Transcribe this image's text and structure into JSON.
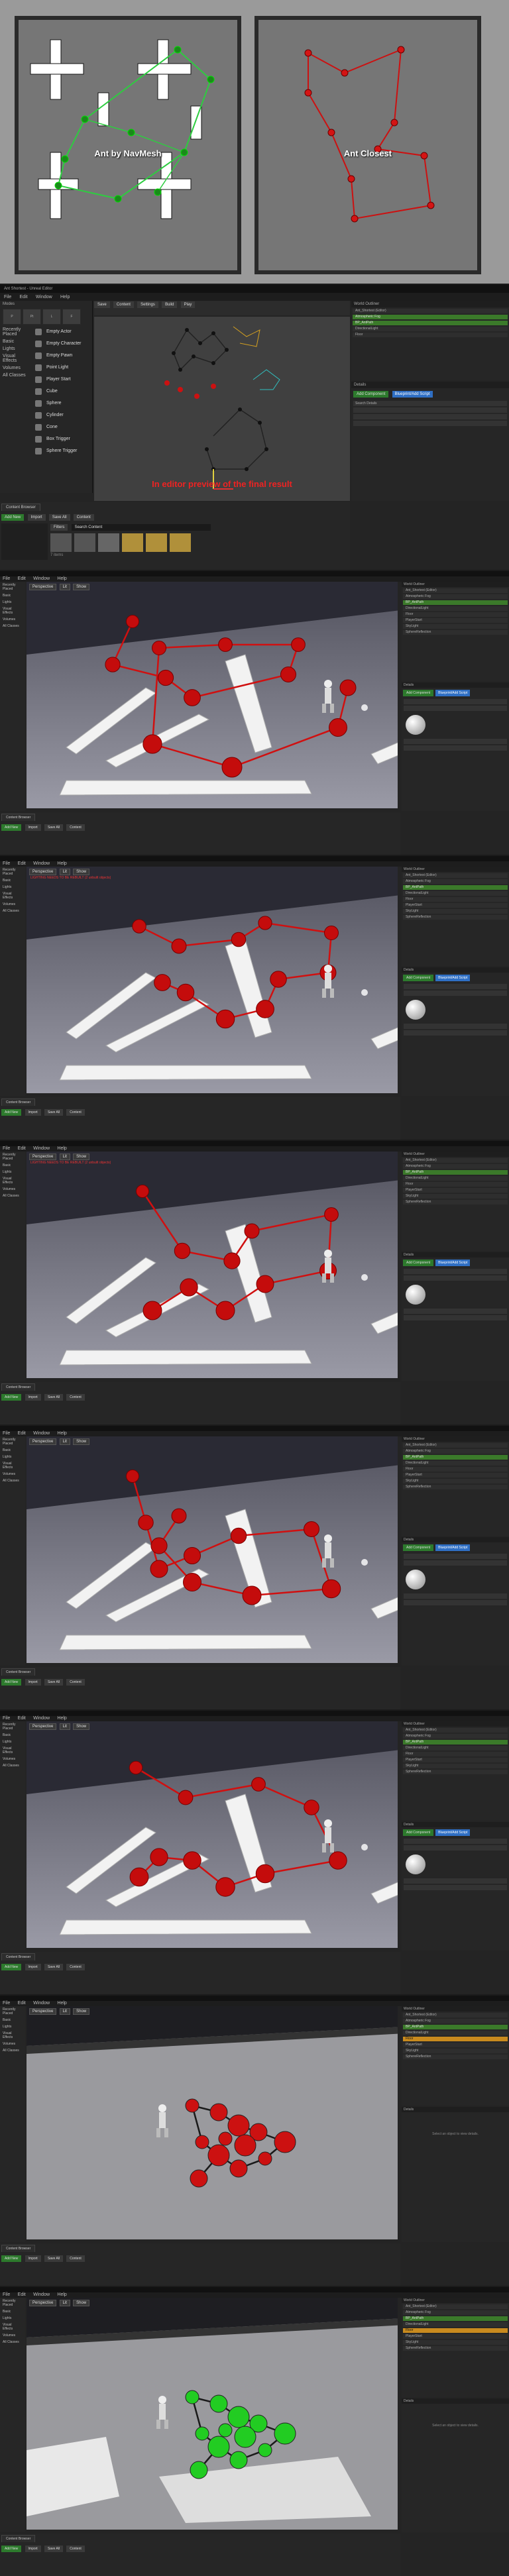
{
  "top": {
    "left_label": "Ant by NavMesh",
    "right_label": "Ant Closest"
  },
  "editor": {
    "window_title": "Ant Shortest - Unreal Editor",
    "menu": [
      "File",
      "Edit",
      "Window",
      "Help"
    ],
    "toolbar": [
      "Save",
      "Source Control",
      "Content",
      "Marketplace",
      "Settings",
      "Blueprints",
      "Matinee",
      "Build",
      "Play",
      "Launch"
    ],
    "modes_title": "Modes",
    "place_categories": [
      "Recently Placed",
      "Basic",
      "Lights",
      "Visual Effects",
      "Volumes",
      "All Classes"
    ],
    "place_items": [
      "Empty Actor",
      "Empty Character",
      "Empty Pawn",
      "Point Light",
      "Player Start",
      "Cube",
      "Sphere",
      "Cylinder",
      "Cone",
      "Box Trigger",
      "Sphere Trigger"
    ],
    "caption": "In editor preview of the final result",
    "content_browser": "Content Browser",
    "add_new": "Add New",
    "import": "Import",
    "save_all": "Save All",
    "content": "Content",
    "filters": "Filters",
    "search_placeholder": "Search Content",
    "items_count": "7 items",
    "view_options": "View Options",
    "outliner_title": "World Outliner",
    "details_title": "Details",
    "add_component": "Add Component",
    "blueprint_add_script": "Blueprint/Add Script",
    "search_details": "Search Details",
    "outliner_rows": [
      "Ant_Shortest (Editor)",
      "Atmospheric Fog",
      "BP_AntPath",
      "DirectionalLight",
      "Floor",
      "PlayerStart",
      "SkyLight",
      "SphereReflection"
    ]
  },
  "viewports": [
    {
      "mode": "Perspective",
      "lit": "Lit",
      "show": "Show",
      "warning": ""
    },
    {
      "mode": "Perspective",
      "lit": "Lit",
      "show": "Show",
      "warning": "LIGHTING NEEDS TO BE REBUILT (2 unbuilt objects)"
    },
    {
      "mode": "Perspective",
      "lit": "Lit",
      "show": "Show",
      "warning": "LIGHTING NEEDS TO BE REBUILT (2 unbuilt objects)"
    },
    {
      "mode": "Perspective",
      "lit": "Lit",
      "show": "Show",
      "warning": ""
    },
    {
      "mode": "Perspective",
      "lit": "Lit",
      "show": "Show",
      "warning": ""
    },
    {
      "mode": "Perspective",
      "lit": "Lit",
      "show": "Show",
      "warning": ""
    },
    {
      "mode": "Perspective",
      "lit": "Lit",
      "show": "Show",
      "warning": ""
    }
  ],
  "select_object": "Select an object to view details.",
  "colors": {
    "red": "#cc1111",
    "green": "#22cc22",
    "accent": "#c88a1e",
    "blue": "#2f6fc4"
  }
}
